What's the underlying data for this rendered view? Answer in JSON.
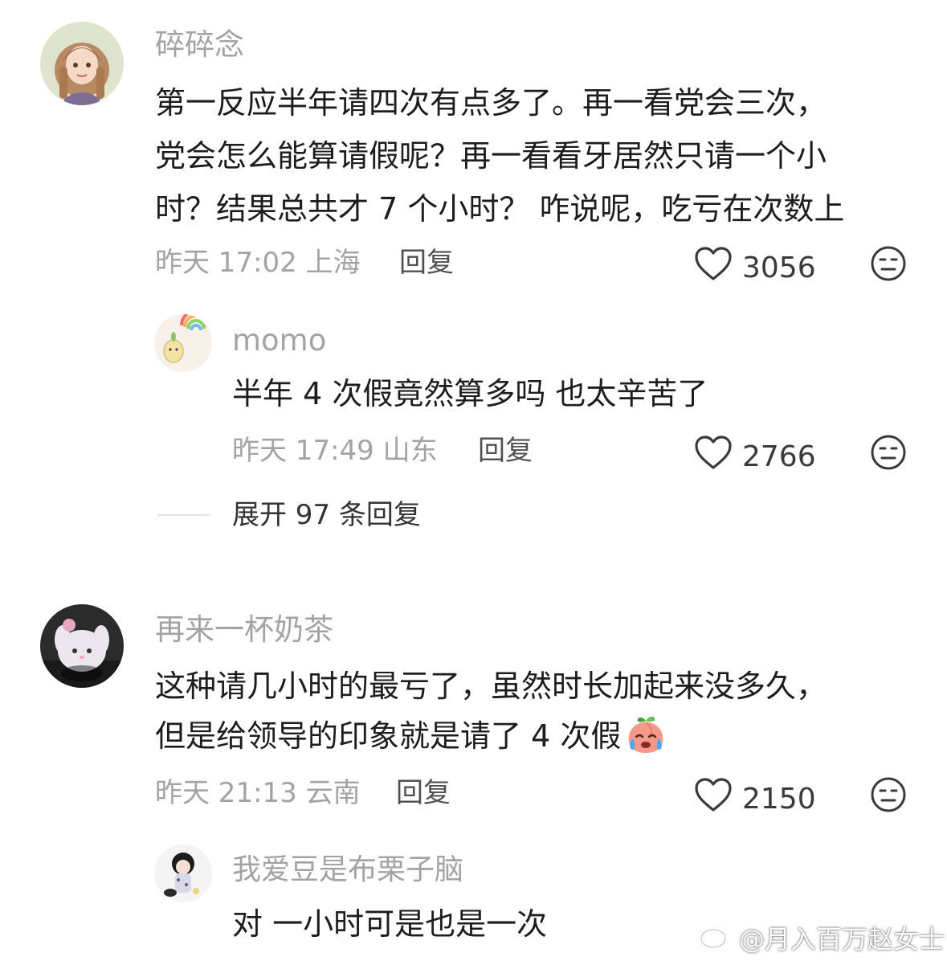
{
  "comments": [
    {
      "username": "碎碎念",
      "lines": [
        "第一反应半年请四次有点多了。再一看党会三次，",
        "党会怎么能算请假呢？再一看看牙居然只请一个小",
        "时？结果总共才 7 个小时？  咋说呢，吃亏在次数上"
      ],
      "meta": "昨天 17:02 上海",
      "reply_label": "回复",
      "likes": "3056",
      "replies": [
        {
          "username": "momo",
          "text": "半年 4 次假竟然算多吗 也太辛苦了",
          "meta": "昨天 17:49 山东",
          "reply_label": "回复",
          "likes": "2766"
        }
      ],
      "expand_label": "展开 97 条回复"
    },
    {
      "username": "再来一杯奶茶",
      "lines": [
        "这种请几小时的最亏了，虽然时长加起来没多久，",
        "但是给领导的印象就是请了 4 次假"
      ],
      "meta": "昨天 21:13 云南",
      "reply_label": "回复",
      "likes": "2150",
      "replies": [
        {
          "username": "我爱豆是布栗子脑",
          "text": "对 一小时可是也是一次"
        }
      ]
    }
  ],
  "watermark": "@月入百万赵女士",
  "icons": {
    "like": "heart-outline-icon",
    "dislike": "neutral-face-icon",
    "emoji": "crying-peach-emoji",
    "watermark": "weibo-logo-icon"
  }
}
